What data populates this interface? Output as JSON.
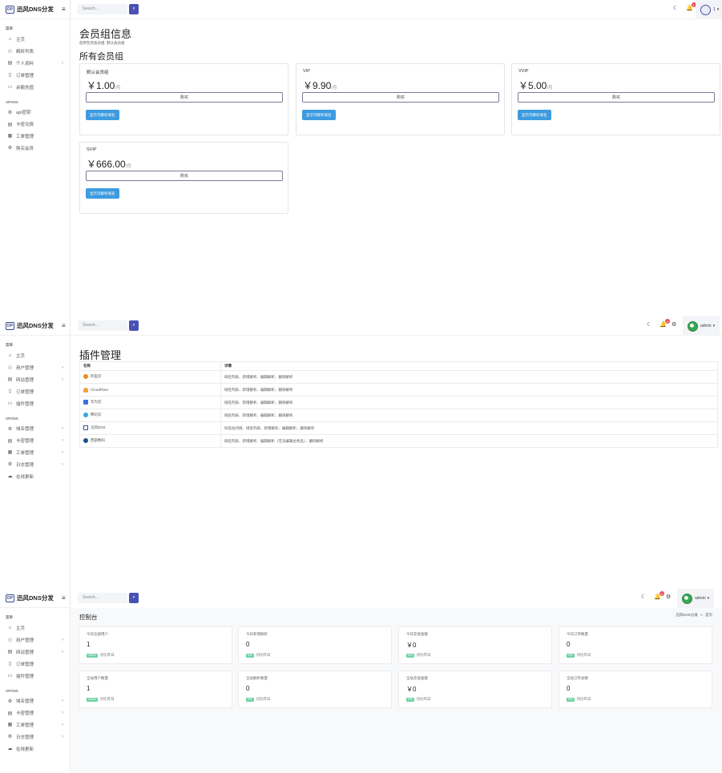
{
  "brand": {
    "logo": "DP",
    "name": "迅风DNS分发"
  },
  "search": {
    "placeholder": "Search..."
  },
  "panel1": {
    "nav": {
      "section1": "菜单",
      "items1": [
        {
          "label": "主页",
          "icon": "home-icon",
          "chevron": false
        },
        {
          "label": "解析列表",
          "icon": "users-icon",
          "chevron": false
        },
        {
          "label": "个人资料",
          "icon": "card-icon",
          "chevron": true
        },
        {
          "label": "订单管理",
          "icon": "doc-icon",
          "chevron": false
        },
        {
          "label": "余额充值",
          "icon": "folder-icon",
          "chevron": false
        }
      ],
      "section2": "SPONS",
      "items2": [
        {
          "label": "api密钥",
          "icon": "gear-icon",
          "chevron": false
        },
        {
          "label": "卡密兑换",
          "icon": "card-icon",
          "chevron": false
        },
        {
          "label": "工单管理",
          "icon": "grid-icon",
          "chevron": false
        },
        {
          "label": "购买会员",
          "icon": "gear-icon",
          "chevron": false
        }
      ]
    },
    "user": {
      "name": "1",
      "avatar": "avatar-icon",
      "notif": "1"
    },
    "title": "会员组信息",
    "subtitle": "您所在的会员组: 默认会员组",
    "section": "所有会员组",
    "buy_label": "购买",
    "show_label": "显示可解析域名",
    "plans": [
      {
        "name": "默认会员组",
        "price": "￥1.00",
        "unit": "/月"
      },
      {
        "name": "VIP",
        "price": "￥9.90",
        "unit": "/月"
      },
      {
        "name": "VVIP",
        "price": "￥5.00",
        "unit": "/月"
      },
      {
        "name": "SVIP",
        "price": "￥666.00",
        "unit": "/月"
      }
    ]
  },
  "panel2": {
    "nav": {
      "section1": "菜单",
      "items1": [
        {
          "label": "主页",
          "chevron": false
        },
        {
          "label": "用户管理",
          "chevron": true
        },
        {
          "label": "网站管理",
          "chevron": true
        },
        {
          "label": "订单管理",
          "chevron": false
        },
        {
          "label": "插件管理",
          "chevron": false
        }
      ],
      "section2": "SPONS",
      "items2": [
        {
          "label": "域名管理",
          "chevron": true
        },
        {
          "label": "卡密管理",
          "chevron": true
        },
        {
          "label": "工单管理",
          "chevron": true
        },
        {
          "label": "日志管理",
          "chevron": true
        },
        {
          "label": "在线更新",
          "chevron": false
        }
      ]
    },
    "user": {
      "name": "admin",
      "notif": "3"
    },
    "title": "插件管理",
    "table": {
      "headers": [
        "名称",
        "详情"
      ],
      "rows": [
        {
          "name": "阿里云",
          "detail": "域名列表、新增解析、编辑解析、删除解析",
          "color": "#f08a24"
        },
        {
          "name": "CloudFlare",
          "detail": "域名列表、新增解析、编辑解析、删除解析",
          "color": "#f6a03a"
        },
        {
          "name": "华为云",
          "detail": "域名列表、新增解析、编辑解析、删除解析",
          "color": "#3a6ee0"
        },
        {
          "name": "腾讯云",
          "detail": "域名列表、新增解析、编辑解析、删除解析",
          "color": "#33a7e8"
        },
        {
          "name": "迅风DNS",
          "detail": "同名站对接、域名列表、新增解析、编辑解析、删除解析",
          "color": "#3b4a8c"
        },
        {
          "name": "西部数码",
          "detail": "域名列表、新增解析、编辑解析（无法编辑主机名）、删除解析",
          "color": "#1e4d8c"
        }
      ]
    }
  },
  "panel3": {
    "user": {
      "name": "admin",
      "notif": "3"
    },
    "title": "控制台",
    "breadcrumb": [
      "迅风DNS分发",
      ">",
      "首页"
    ],
    "stats": [
      {
        "label": "今日注册用户",
        "value": "1",
        "pct": "100%",
        "foot": "对比昨日"
      },
      {
        "label": "今日新增解析",
        "value": "0",
        "pct": "0%",
        "foot": "对比昨日"
      },
      {
        "label": "今日充值金额",
        "value": "￥0",
        "pct": "0%",
        "foot": "对比昨日"
      },
      {
        "label": "今日订单数量",
        "value": "0",
        "pct": "0%",
        "foot": "对比昨日"
      },
      {
        "label": "全站用户数量",
        "value": "1",
        "pct": "100%",
        "foot": "对比昨日"
      },
      {
        "label": "全站解析数量",
        "value": "0",
        "pct": "0%",
        "foot": "对比昨日"
      },
      {
        "label": "全站充值金额",
        "value": "￥0",
        "pct": "0%",
        "foot": "对比昨日"
      },
      {
        "label": "全站订单总数",
        "value": "0",
        "pct": "0%",
        "foot": "对比昨日"
      }
    ]
  }
}
